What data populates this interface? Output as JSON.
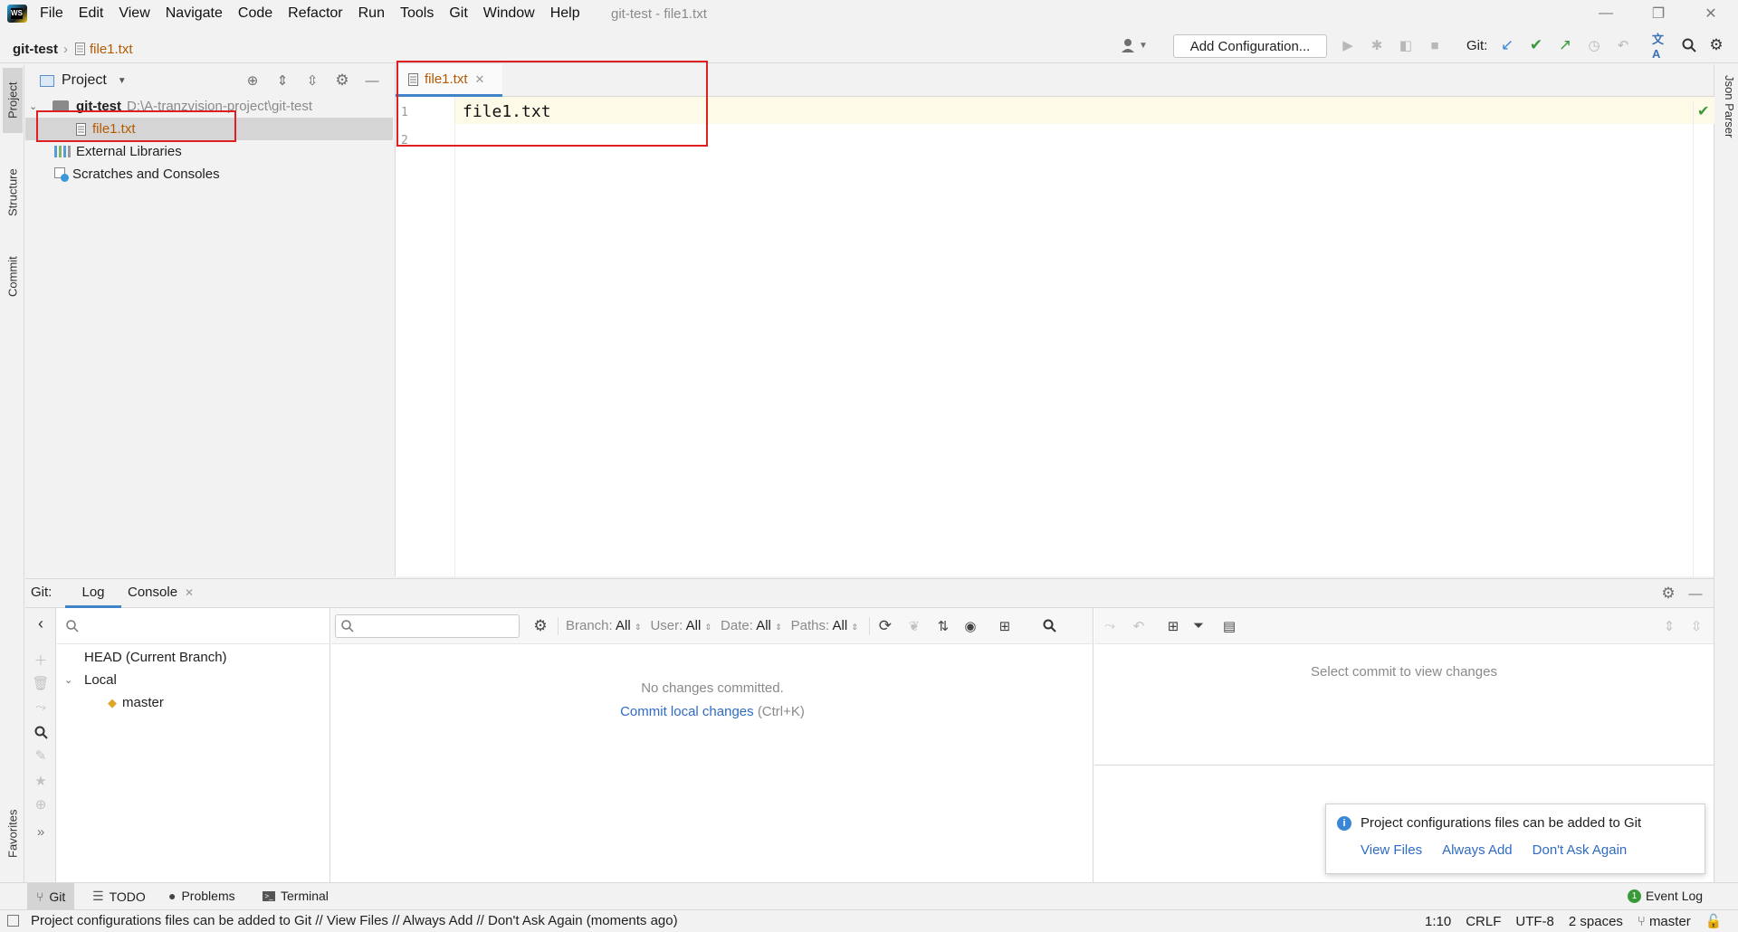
{
  "titlebar": {
    "menu": [
      "File",
      "Edit",
      "View",
      "Navigate",
      "Code",
      "Refactor",
      "Run",
      "Tools",
      "Git",
      "Window",
      "Help"
    ],
    "window_title": "git-test - file1.txt"
  },
  "navbar": {
    "project": "git-test",
    "file": "file1.txt",
    "add_configuration": "Add Configuration...",
    "git_label": "Git:"
  },
  "left_strip": {
    "project": "Project",
    "structure": "Structure",
    "commit": "Commit",
    "favorites": "Favorites"
  },
  "right_strip": {
    "json_parser": "Json Parser"
  },
  "project_panel": {
    "title": "Project",
    "root_name": "git-test",
    "root_path": "D:\\A-tranzvision-project\\git-test",
    "file": "file1.txt",
    "external_libraries": "External Libraries",
    "scratches": "Scratches and Consoles"
  },
  "editor": {
    "tab_label": "file1.txt",
    "line_numbers": [
      "1",
      "2"
    ],
    "code_line1": "file1.txt"
  },
  "git_window": {
    "label": "Git:",
    "tabs": [
      "Log",
      "Console"
    ],
    "branches": {
      "head": "HEAD (Current Branch)",
      "local": "Local",
      "master": "master"
    },
    "filters": {
      "branch": "Branch:",
      "branch_val": "All",
      "user": "User:",
      "user_val": "All",
      "date": "Date:",
      "date_val": "All",
      "paths": "Paths:",
      "paths_val": "All"
    },
    "log_empty": "No changes committed.",
    "commit_link": "Commit local changes",
    "commit_shortcut": "(Ctrl+K)",
    "details_empty": "Select commit to view changes"
  },
  "notification": {
    "message": "Project configurations files can be added to Git",
    "actions": [
      "View Files",
      "Always Add",
      "Don't Ask Again"
    ]
  },
  "bottom_tabs": [
    "Git",
    "TODO",
    "Problems",
    "Terminal"
  ],
  "event_log": {
    "count": "1",
    "label": "Event Log"
  },
  "statusbar": {
    "message": "Project configurations files can be added to Git // View Files // Always Add // Don't Ask Again (moments ago)",
    "position": "1:10",
    "line_sep": "CRLF",
    "encoding": "UTF-8",
    "indent": "2 spaces",
    "branch": "master"
  },
  "colors": {
    "accent": "#4083c9",
    "highlight": "#e02020",
    "file_modified": "#b35a00",
    "link": "#2f6bc4"
  }
}
